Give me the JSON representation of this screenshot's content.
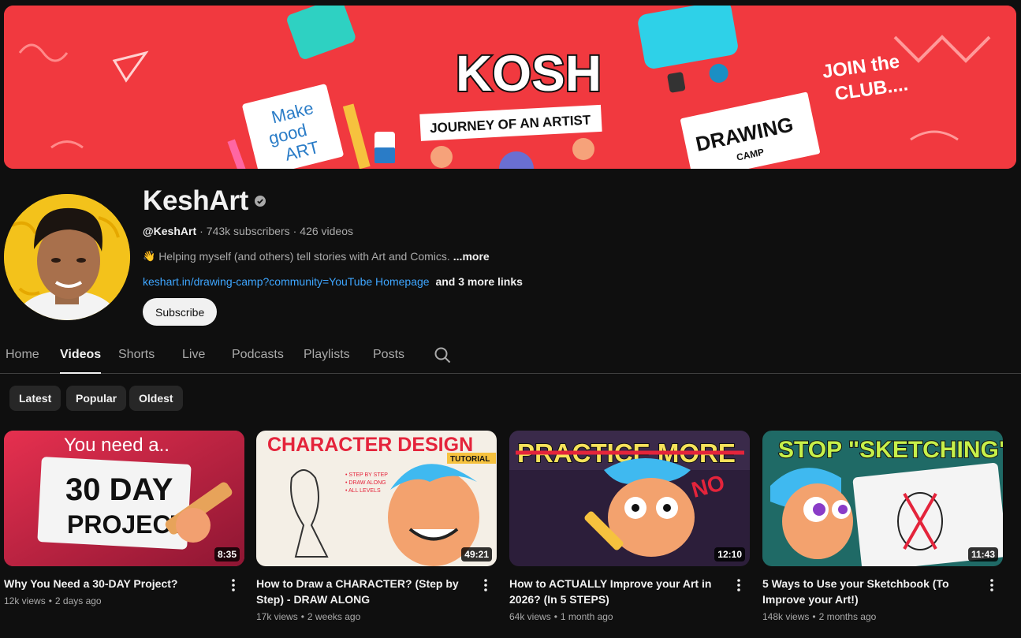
{
  "banner": {
    "logo_text": "KOSH",
    "tagline": "JOURNEY OF AN ARTIST",
    "sketchbook_text": [
      "Make",
      "good",
      "ART"
    ],
    "join_text": [
      "JOIN the",
      "CLUB...."
    ],
    "camp_text": [
      "DRAWING",
      "CAMP"
    ],
    "background_color": "#f1393f"
  },
  "channel": {
    "name": "KeshArt",
    "handle": "@KeshArt",
    "subscribers": "743k subscribers",
    "videos_count": "426 videos",
    "description_emoji": "👋",
    "description": "Helping myself (and others) tell stories with Art and Comics.",
    "more_label": "...more",
    "link_text": "keshart.in/drawing-camp?community=YouTube Homepage",
    "extra_links": "and 3 more links",
    "subscribe_label": "Subscribe",
    "verified_icon": "check-circle-icon"
  },
  "tabs": [
    {
      "label": "Home",
      "active": false
    },
    {
      "label": "Videos",
      "active": true
    },
    {
      "label": "Shorts",
      "active": false
    },
    {
      "label": "Live",
      "active": false
    },
    {
      "label": "Podcasts",
      "active": false
    },
    {
      "label": "Playlists",
      "active": false
    },
    {
      "label": "Posts",
      "active": false
    }
  ],
  "search_icon": "search-icon",
  "chips": [
    "Latest",
    "Popular",
    "Oldest"
  ],
  "videos": [
    {
      "title": "Why You Need a 30-DAY Project?",
      "views": "12k views",
      "age": "2 days ago",
      "duration": "8:35",
      "thumb_text": [
        "You need a..",
        "30 DAY",
        "PROJECT"
      ]
    },
    {
      "title": "How to Draw a CHARACTER? (Step by Step) - DRAW ALONG",
      "views": "17k views",
      "age": "2 weeks ago",
      "duration": "49:21",
      "thumb_text": [
        "CHARACTER DESIGN",
        "TUTORIAL",
        "• STEP BY STEP",
        "• DRAW ALONG",
        "• ALL LEVELS"
      ]
    },
    {
      "title": "How to ACTUALLY Improve your Art in 2026? (In 5 STEPS)",
      "views": "64k views",
      "age": "1 month ago",
      "duration": "12:10",
      "thumb_text": [
        "PRACTICE MORE",
        "NO"
      ]
    },
    {
      "title": "5 Ways to Use your Sketchbook (To Improve your Art!)",
      "views": "148k views",
      "age": "2 months ago",
      "duration": "11:43",
      "thumb_text": [
        "STOP \"SKETCHING\""
      ]
    }
  ]
}
